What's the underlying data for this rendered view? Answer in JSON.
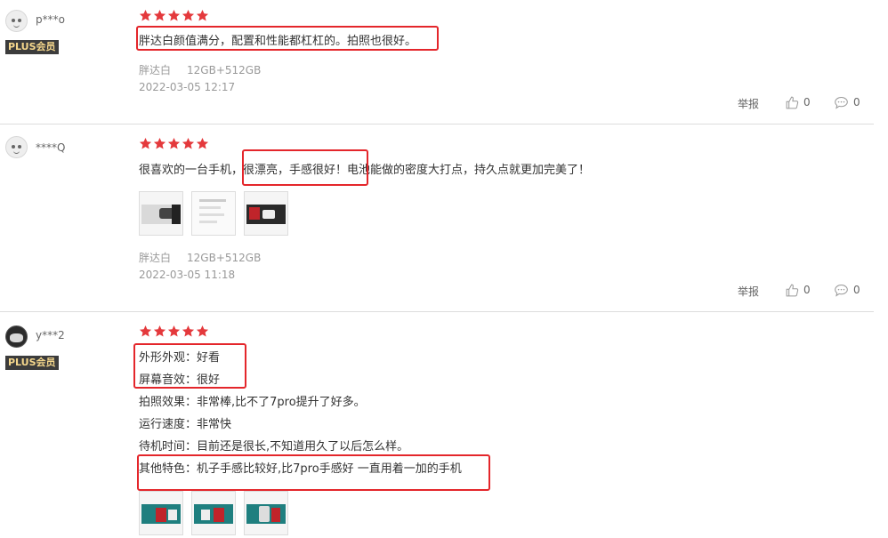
{
  "reviews": [
    {
      "user": "p***o",
      "plus_badge": "PLUS会员",
      "stars": 5,
      "content": [
        "胖达白颜值满分，配置和性能都杠杠的。拍照也很好。"
      ],
      "color": "胖达白",
      "spec": "12GB+512GB",
      "date": "2022-03-05 12:17",
      "report": "举报",
      "likes": "0",
      "comments": "0",
      "images": []
    },
    {
      "user": "****Q",
      "plus_badge": "",
      "stars": 5,
      "content": [
        "很喜欢的一台手机，很漂亮，手感很好！电池能做的密度大打点，持久点就更加完美了！"
      ],
      "color": "胖达白",
      "spec": "12GB+512GB",
      "date": "2022-03-05 11:18",
      "report": "举报",
      "likes": "0",
      "comments": "0",
      "images": [
        "phone-back-image",
        "settings-screenshot-image",
        "phone-box-image"
      ]
    },
    {
      "user": "y***2",
      "plus_badge": "PLUS会员",
      "stars": 5,
      "content": [
        "外形外观：好看",
        "屏幕音效：很好",
        "拍照效果：非常棒,比不了7pro提升了好多。",
        "运行速度：非常快",
        "待机时间：目前还是很长,不知道用久了以后怎么样。",
        "其他特色：机子手感比较好,比7pro手感好 一直用着一加的手机"
      ],
      "images": [
        "phone-photo-1",
        "phone-photo-2",
        "phone-photo-3"
      ]
    }
  ],
  "colors": {
    "star": "#e4393c",
    "highlight": "#e4262b",
    "badge_bg": "#3c3c3c",
    "badge_text": "#f5d78c"
  }
}
